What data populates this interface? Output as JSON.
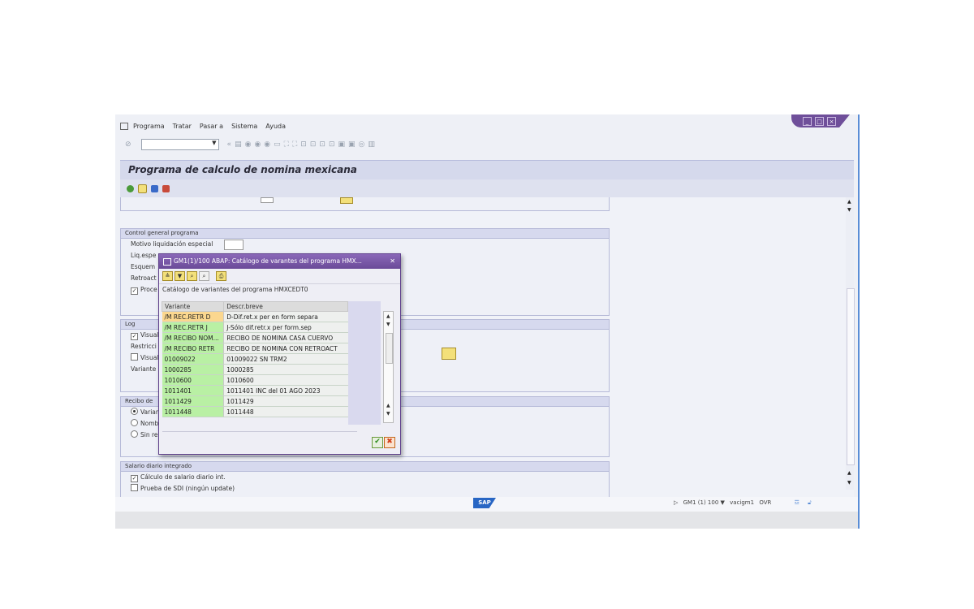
{
  "menu": {
    "items": [
      "Programa",
      "Tratar",
      "Pasar a",
      "Sistema",
      "Ayuda"
    ]
  },
  "page": {
    "title": "Programa de calculo de nomina mexicana"
  },
  "groups": {
    "control": {
      "title": "Control general programa",
      "rows": [
        "Motivo liquidación especial",
        "Liq.espe",
        "Esquem",
        "Retroact",
        "Proce"
      ]
    },
    "log": {
      "title": "Log",
      "rows": [
        "Visual",
        "Restricci",
        "Visual",
        "Variante"
      ]
    },
    "recibo": {
      "title": "Recibo de",
      "rows": [
        "Varian",
        "Nomb",
        "Sin re"
      ]
    },
    "salario": {
      "title": "Salario diario integrado",
      "rows": [
        "Cálculo de salario diario int.",
        "Prueba de SDI (ningún update)"
      ]
    }
  },
  "dialog": {
    "title": "GM1(1)/100 ABAP: Catálogo de varantes del programa HMX...",
    "subtitle": "Catálogo de variantes del programa HMXCEDT0",
    "columns": [
      "Variante",
      "Descr.breve"
    ],
    "rows": [
      [
        "/M REC.RETR D",
        "D-Dif.ret.x per en form separa"
      ],
      [
        "/M REC.RETR J",
        "J-Sólo dif.retr.x per form.sep"
      ],
      [
        "/M RECIBO NOM...",
        "RECIBO DE NOMINA CASA CUERVO"
      ],
      [
        "/M RECIBO RETR",
        "RECIBO DE NOMINA CON RETROACT"
      ],
      [
        "01009022",
        "01009022 SN TRM2"
      ],
      [
        "1000285",
        "1000285"
      ],
      [
        "1010600",
        "1010600"
      ],
      [
        "1011401",
        "1011401 INC del 01 AGO 2023"
      ],
      [
        "1011429",
        "1011429"
      ],
      [
        "1011448",
        "1011448"
      ]
    ]
  },
  "status": {
    "sap_logo": "SAP",
    "system": "GM1 (1) 100",
    "user": "vacigm1",
    "mode": "OVR"
  },
  "colors": {
    "title_band": "#d5d9ec",
    "dialog_title": "#6a4a98",
    "variant_key_bg": "#b9f0a4",
    "selected_key_bg": "#fbd78f"
  }
}
